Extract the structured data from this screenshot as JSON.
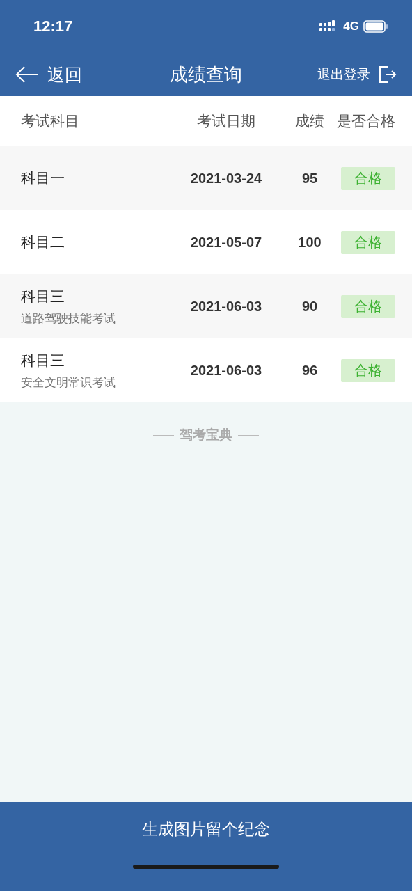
{
  "status_bar": {
    "time": "12:17",
    "network": "4G"
  },
  "nav": {
    "back": "返回",
    "title": "成绩查询",
    "logout": "退出登录"
  },
  "table": {
    "columns": [
      "考试科目",
      "考试日期",
      "成绩",
      "是否合格"
    ],
    "rows": [
      {
        "subject": "科目一",
        "date": "2021-03-24",
        "score": "95",
        "result": {
          "text": "合格",
          "kind": "pass"
        }
      },
      {
        "subject": "科目二",
        "date": "2021-05-07",
        "score": "100",
        "result": {
          "text": "合格",
          "kind": "pass"
        }
      },
      {
        "subject": "科目三",
        "note": "道路驾驶技能考试",
        "date": "2021-06-03",
        "score": "90",
        "result": {
          "text": "合格",
          "kind": "pass"
        }
      },
      {
        "subject": "科目三",
        "note": "安全文明常识考试",
        "date": "2021-06-03",
        "score": "96",
        "result": {
          "text": "合格",
          "kind": "pass"
        }
      }
    ]
  },
  "footer_brand": "驾考宝典",
  "action_button": "生成图片留个纪念"
}
